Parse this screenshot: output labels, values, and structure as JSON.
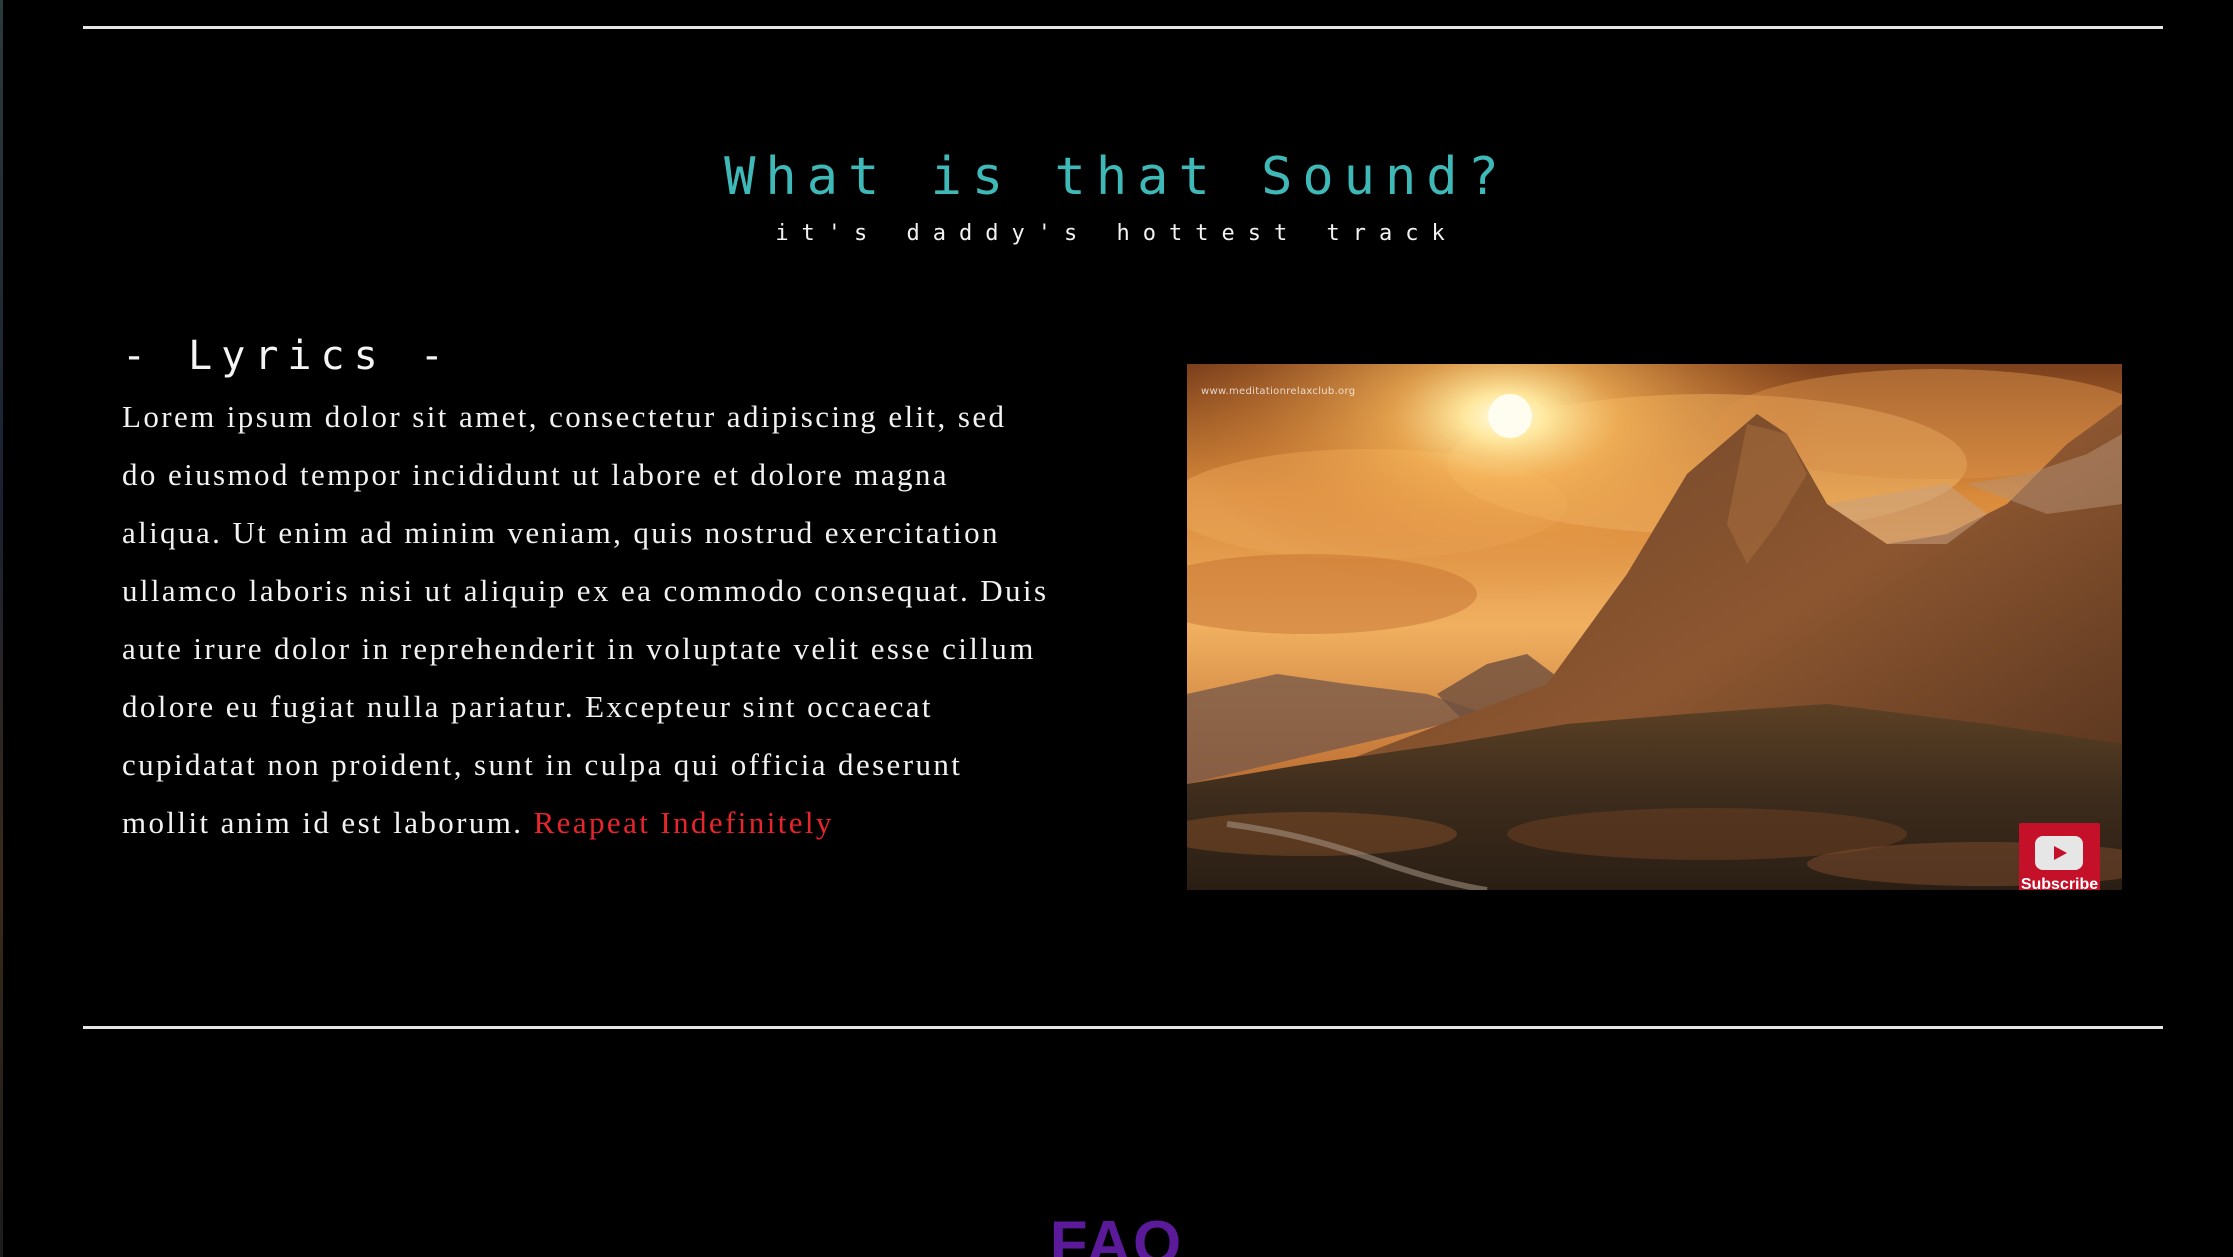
{
  "section": {
    "title": "What is that Sound?",
    "subtitle": "it's daddy's hottest track"
  },
  "lyrics": {
    "heading": "- Lyrics -",
    "text": "Lorem ipsum dolor sit amet, consectetur adipiscing elit, sed do eiusmod tempor incididunt ut labore et dolore magna aliqua. Ut enim ad minim veniam, quis nostrud exercitation ullamco laboris nisi ut aliquip ex ea commodo consequat. Duis aute irure dolor in reprehenderit in voluptate velit esse cillum dolore eu fugiat nulla pariatur. Excepteur sint occaecat cupidatat non proident, sunt in culpa qui officia deserunt mollit anim id est laborum. ",
    "link_label": "Reapeat Indefinitely",
    "link_color": "#e8242c"
  },
  "video": {
    "watermark": "www.meditationrelaxclub.org",
    "subscribe_label": "Subscribe",
    "icon": "youtube-play-icon"
  },
  "faq": {
    "heading": "FAQ"
  },
  "colors": {
    "background": "#000000",
    "title": "#3fb8b8",
    "faq": "#5a1a9a",
    "divider": "#e6e6e6",
    "subscribe": "#c5102a"
  }
}
